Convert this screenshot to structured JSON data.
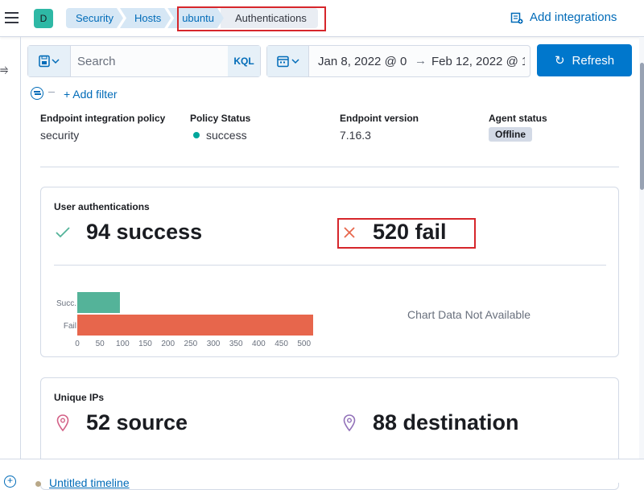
{
  "header": {
    "avatar_letter": "D",
    "breadcrumbs": [
      "Security",
      "Hosts",
      "ubuntu",
      "Authentications"
    ],
    "add_integrations_label": "Add integrations"
  },
  "query_bar": {
    "search_placeholder": "Search",
    "language_label": "KQL",
    "date_start": "Jan 8, 2022 @ 0",
    "date_end": "Feb 12, 2022 @ 1",
    "date_arrow": "→",
    "refresh_label": "Refresh",
    "add_filter_label": "+ Add filter"
  },
  "host_overview": {
    "fields": [
      {
        "label": "Endpoint integration policy",
        "value": "security"
      },
      {
        "label": "Policy Status",
        "value": "success"
      },
      {
        "label": "Endpoint version",
        "value": "7.16.3"
      },
      {
        "label": "Agent status",
        "value": "Offline"
      }
    ]
  },
  "user_authentications": {
    "title": "User authentications",
    "success_label": "94 success",
    "fail_label": "520 fail",
    "no_data_label": "Chart Data Not Available"
  },
  "unique_ips": {
    "title": "Unique IPs",
    "source_label": "52 source",
    "destination_label": "88 destination"
  },
  "timeline": {
    "name": "Untitled timeline"
  },
  "colors": {
    "accent": "#0077cc",
    "success_bar": "#54b399",
    "fail_bar": "#e7664c",
    "source_icon": "#d36086",
    "destination_icon": "#9170b8"
  },
  "icons": [
    "menu-icon",
    "saved-query-icon",
    "calendar-icon",
    "refresh-icon",
    "filter-icon",
    "check-icon",
    "cross-icon",
    "map-pin-icon",
    "add-integrations-icon",
    "plus-circle-icon"
  ],
  "chart_data": {
    "type": "bar",
    "orientation": "horizontal",
    "categories": [
      "Succ.",
      "Fail"
    ],
    "values": [
      94,
      520
    ],
    "colors": [
      "#54b399",
      "#e7664c"
    ],
    "xticks": [
      0,
      50,
      100,
      150,
      200,
      250,
      300,
      350,
      400,
      450,
      500
    ],
    "xlim": [
      0,
      520
    ]
  }
}
